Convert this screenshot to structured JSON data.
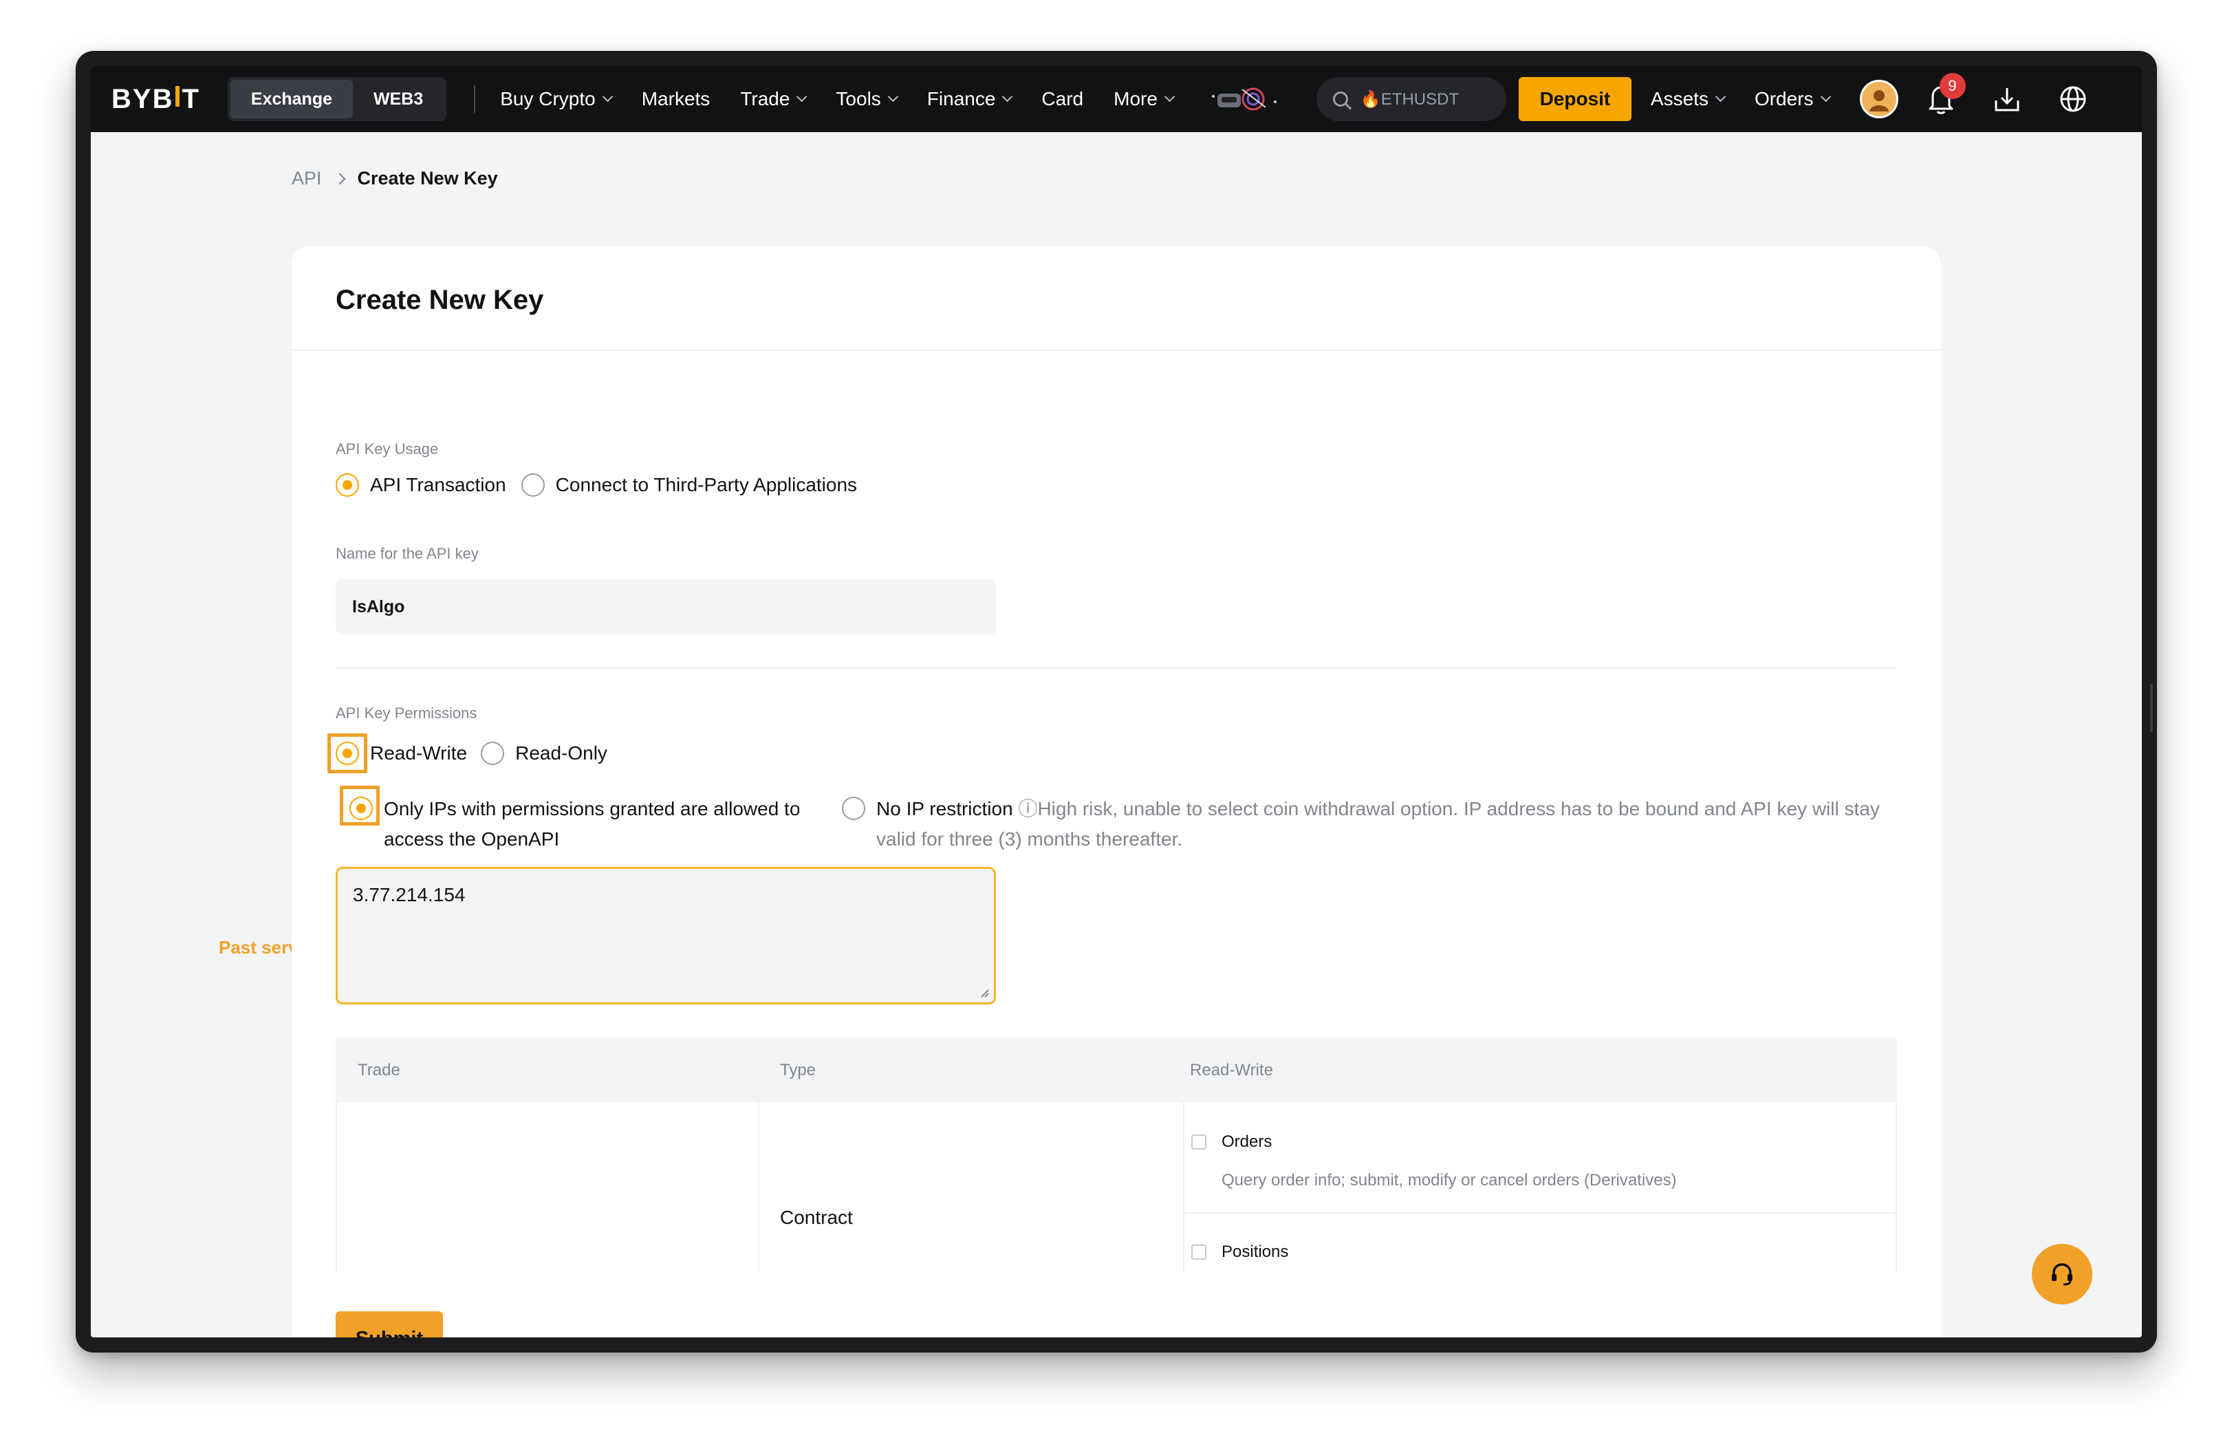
{
  "nav": {
    "logo": "BYBIT",
    "segments": [
      "Exchange",
      "WEB3"
    ],
    "items": [
      {
        "label": "Buy Crypto",
        "dropdown": true
      },
      {
        "label": "Markets",
        "dropdown": false
      },
      {
        "label": "Trade",
        "dropdown": true
      },
      {
        "label": "Tools",
        "dropdown": true
      },
      {
        "label": "Finance",
        "dropdown": true
      },
      {
        "label": "Card",
        "dropdown": false
      },
      {
        "label": "More",
        "dropdown": true
      }
    ],
    "search_text": "🔥ETHUSDT",
    "deposit_label": "Deposit",
    "assets_label": "Assets",
    "orders_label": "Orders",
    "notification_count": "9",
    "accent": "#f7a600"
  },
  "breadcrumb": {
    "root": "API",
    "current": "Create New Key"
  },
  "form": {
    "title": "Create New Key",
    "usage_label": "API Key Usage",
    "usage_options": [
      "API Transaction",
      "Connect to Third-Party Applications"
    ],
    "name_label": "Name for the API key",
    "name_value": "IsAlgo",
    "permissions_label": "API Key Permissions",
    "permission_options": [
      "Read-Write",
      "Read-Only"
    ],
    "ip_restricted_label": "Only IPs with permissions granted are allowed to access the OpenAPI",
    "no_ip_label": "No IP restriction",
    "no_ip_warning": "ⓘHigh risk, unable to select coin withdrawal option. IP address has to be bound and API key will stay valid for three (3) months thereafter.",
    "ip_value": "3.77.214.154",
    "annotation": "Past server IP here",
    "submit_label": "Submit"
  },
  "table": {
    "headers": [
      "Trade",
      "Type",
      "Read-Write"
    ],
    "type_value": "Contract",
    "permissions": [
      {
        "label": "Orders",
        "description": "Query order info; submit, modify or cancel orders (Derivatives)"
      },
      {
        "label": "Positions",
        "description": ""
      }
    ]
  }
}
